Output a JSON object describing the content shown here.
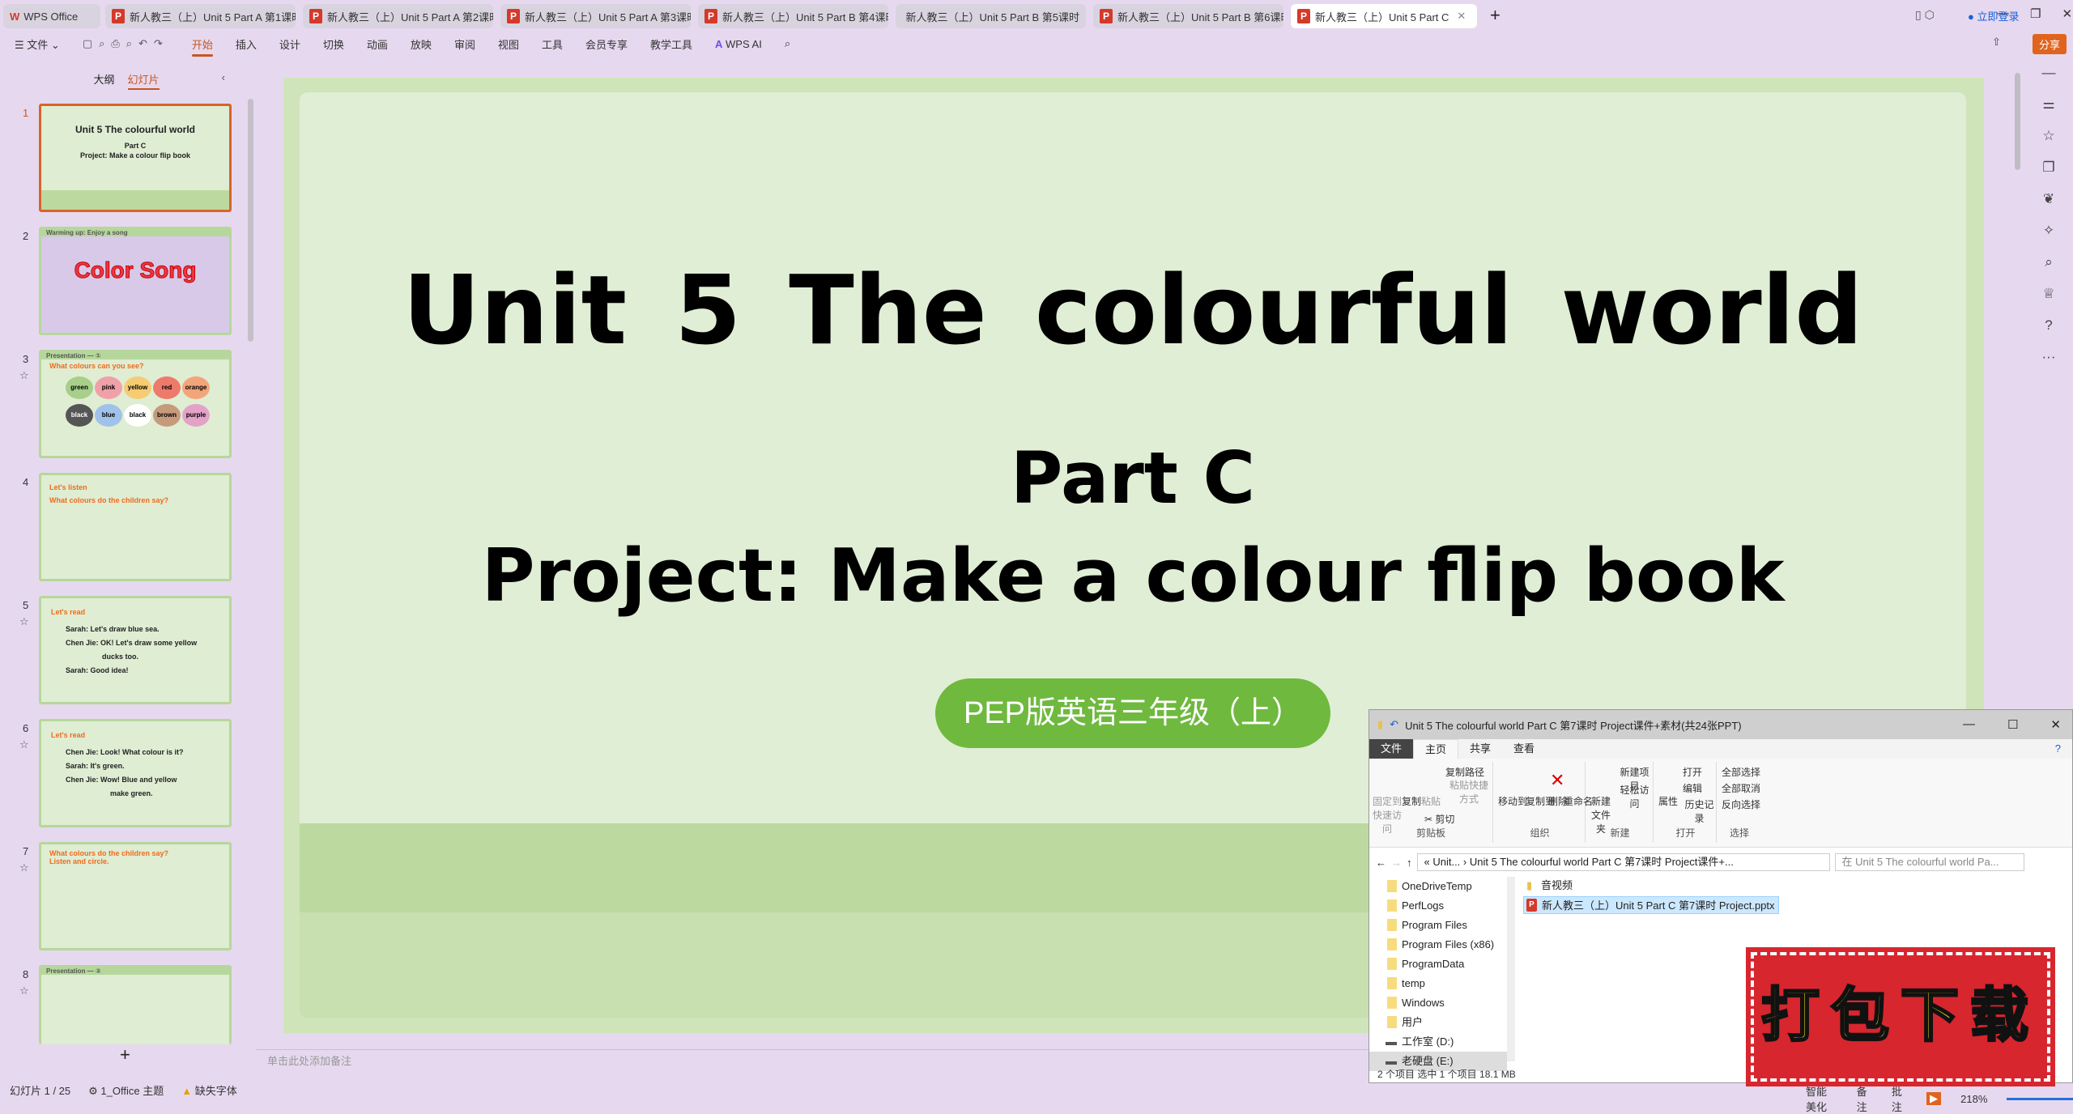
{
  "tabs": [
    {
      "label": "WPS Office"
    },
    {
      "label": "新人教三（上）Unit 5 Part A 第1课时"
    },
    {
      "label": "新人教三（上）Unit 5 Part A 第2课时"
    },
    {
      "label": "新人教三（上）Unit 5 Part A 第3课时"
    },
    {
      "label": "新人教三（上）Unit 5 Part B 第4课时"
    },
    {
      "label": "新人教三（上）Unit 5 Part B 第5课时"
    },
    {
      "label": "新人教三（上）Unit 5 Part B 第6课时"
    },
    {
      "label": "新人教三（上）Unit 5 Part C"
    }
  ],
  "titlebar": {
    "login": "立即登录"
  },
  "ribbon": {
    "file": "文件",
    "items": [
      "开始",
      "插入",
      "设计",
      "切换",
      "动画",
      "放映",
      "审阅",
      "视图",
      "工具",
      "会员专享",
      "教学工具"
    ],
    "wps_ai": "WPS AI",
    "share": "分享"
  },
  "leftpanel": {
    "outline": "大纲",
    "slides": "幻灯片"
  },
  "thumbs": {
    "s1": {
      "t1": "Unit 5  The colourful world",
      "t2": "Part C",
      "t3": "Project: Make a colour flip book"
    },
    "s2": {
      "header": "Warming up: Enjoy a song",
      "title": "Color Song"
    },
    "s3": {
      "header": "Presentation — ①",
      "q": "What colours can you see?",
      "colors": [
        "green",
        "pink",
        "yellow",
        "red",
        "orange",
        "black",
        "blue",
        "black",
        "brown",
        "purple"
      ]
    },
    "s4": {
      "h": "Let's listen",
      "q": "What colours do the children say?"
    },
    "s5": {
      "h": "Let's read",
      "l1": "Sarah: Let's draw blue sea.",
      "l2": "Chen Jie: OK! Let's draw some yellow",
      "l3": "ducks too.",
      "l4": "Sarah: Good idea!"
    },
    "s6": {
      "h": "Let's read",
      "l1": "Chen Jie: Look! What colour is it?",
      "l2": "Sarah: It's green.",
      "l3": "Chen Jie: Wow! Blue and yellow",
      "l4": "make green."
    },
    "s7": {
      "q": "What colours do the children say?",
      "q2": "Listen and circle."
    },
    "s8": {
      "header": "Presentation — ②"
    }
  },
  "slide": {
    "title": "Unit 5   The colourful world",
    "part": "Part C",
    "project": "Project: Make a colour flip book",
    "badge": "PEP版英语三年级（上）"
  },
  "notes": "单击此处添加备注",
  "status": {
    "slide": "幻灯片 1 / 25",
    "theme": "1_Office 主题",
    "missing": "缺失字体",
    "beautify": "智能美化",
    "notes": "备注",
    "comment": "批注",
    "zoom": "218%"
  },
  "explorer": {
    "title": "Unit 5 The colourful world  Part C 第7课时 Project课件+素材(共24张PPT)",
    "tabs": [
      "文件",
      "主页",
      "共享",
      "查看"
    ],
    "groups": {
      "clipboard": "剪贴板",
      "organize": "组织",
      "new": "新建",
      "open": "打开",
      "select": "选择"
    },
    "buttons": {
      "pin": "固定到快速访问",
      "copy": "复制",
      "paste": "粘贴",
      "copypath": "复制路径",
      "pasteshortcut": "粘贴快捷方式",
      "cut": "剪切",
      "moveto": "移动到",
      "copyto": "复制到",
      "delete": "删除",
      "rename": "重命名",
      "newfolder": "新建文件夹",
      "newitem": "新建项目",
      "easyaccess": "轻松访问",
      "properties": "属性",
      "openbtn": "打开",
      "edit": "编辑",
      "history": "历史记录",
      "selectall": "全部选择",
      "selectnone": "全部取消",
      "invert": "反向选择"
    },
    "address": "«  Unit...  ›  Unit 5 The colourful world  Part C 第7课时 Project课件+...",
    "search_placeholder": "在 Unit 5 The colourful world  Pa...",
    "nav": [
      "OneDriveTemp",
      "PerfLogs",
      "Program Files",
      "Program Files (x86)",
      "ProgramData",
      "temp",
      "Windows",
      "用户"
    ],
    "drives": [
      "工作室 (D:)",
      "老硬盘 (E:)"
    ],
    "files": [
      "音视频",
      "新人教三（上）Unit 5 Part C 第7课时 Project.pptx"
    ],
    "status": "2 个项目    选中 1 个项目  18.1 MB"
  },
  "stamp": "打包下载"
}
